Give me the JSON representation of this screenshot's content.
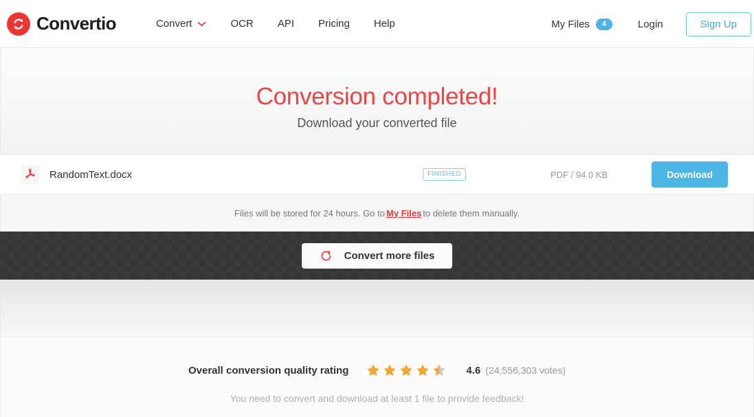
{
  "header": {
    "logo": {
      "icon": "convertio-recycle-icon",
      "text": "Convertio",
      "brand_color": "#ef3434"
    },
    "nav": [
      {
        "label": "Convert",
        "has_dropdown": true,
        "chevron_icon": "chevron-down-icon",
        "chevron_color": "#e5393d"
      },
      {
        "label": "OCR",
        "has_dropdown": false
      },
      {
        "label": "API",
        "has_dropdown": false
      },
      {
        "label": "Pricing",
        "has_dropdown": false
      },
      {
        "label": "Help",
        "has_dropdown": false
      }
    ],
    "my_files": {
      "label": "My Files",
      "count": "4",
      "badge_color": "#4bb4e8"
    },
    "login_label": "Login",
    "signup_label": "Sign Up",
    "signup_color": "#4aa8d8"
  },
  "hero": {
    "title": "Conversion completed!",
    "title_color": "#ef4444",
    "subtitle": "Download your converted file"
  },
  "file_row": {
    "file_icon": "pdf-file-icon",
    "file_name": "RandomText.docx",
    "status": "FINISHED",
    "status_color": "#6cc2e6",
    "meta": "PDF / 94.0 KB",
    "download_label": "Download",
    "download_color": "#4cb6e5"
  },
  "notice": {
    "text_before": "Files will be stored for 24 hours. Go to",
    "link": "My Files",
    "link_color": "#e5393d",
    "text_after": "to delete them manually."
  },
  "cta": {
    "icon": "refresh-circle-icon",
    "icon_color": "#e5393d",
    "label": "Convert more files"
  },
  "rating": {
    "label": "Overall conversion quality rating",
    "stars": [
      {
        "fill": "full"
      },
      {
        "fill": "full"
      },
      {
        "fill": "full"
      },
      {
        "fill": "full"
      },
      {
        "fill": "half"
      }
    ],
    "star_color": "#f0a732",
    "star_empty_color": "#c9c9c9",
    "value": "4.6",
    "votes": "(24,556,303 votes)",
    "feedback_note": "You need to convert and download at least 1 file to provide feedback!"
  }
}
